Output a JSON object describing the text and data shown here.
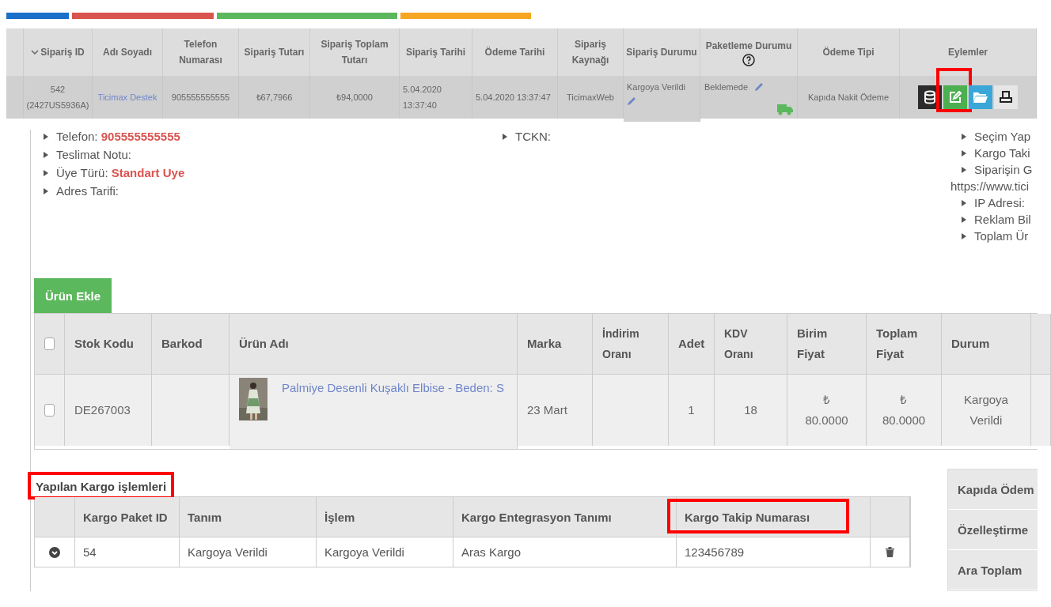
{
  "progress_bars": [
    {
      "color": "#1a6fc9"
    },
    {
      "color": "#d9534f"
    },
    {
      "color": "#5cb85c"
    },
    {
      "color": "#f6a623"
    }
  ],
  "orders_table": {
    "columns": [
      {
        "label": "Sipariş ID",
        "sorted": true,
        "help": false
      },
      {
        "label": "Adı Soyadı",
        "sorted": false,
        "help": false
      },
      {
        "label": "Telefon Numarası",
        "sorted": false,
        "help": false
      },
      {
        "label": "Sipariş Tutarı",
        "sorted": false,
        "help": false
      },
      {
        "label": "Sipariş Toplam Tutarı",
        "sorted": false,
        "help": false
      },
      {
        "label": "Sipariş Tarihi",
        "sorted": false,
        "help": false
      },
      {
        "label": "Ödeme Tarihi",
        "sorted": false,
        "help": false
      },
      {
        "label": "Sipariş Kaynağı",
        "sorted": false,
        "help": false
      },
      {
        "label": "Sipariş Durumu",
        "sorted": false,
        "help": false
      },
      {
        "label": "Paketleme Durumu",
        "sorted": false,
        "help": true
      },
      {
        "label": "Ödeme Tipi",
        "sorted": false,
        "help": false
      },
      {
        "label": "Eylemler",
        "sorted": false,
        "help": false
      }
    ],
    "row": {
      "order_id": "542",
      "order_code": "(2427US5936A)",
      "customer": "Ticimax Destek",
      "phone": "905555555555",
      "amount": "₺67,7966",
      "total": "₺94,0000",
      "order_date": "5.04.2020 13:37:40",
      "payment_date": "5.04.2020 13:37:47",
      "source": "TicimaxWeb",
      "status": "Kargoya Verildi",
      "packaging": "Beklemede",
      "payment_type": "Kapıda Nakit Ödeme",
      "actions": [
        {
          "kind": "database",
          "highlighted": false
        },
        {
          "kind": "edit",
          "highlighted": true
        },
        {
          "kind": "folder",
          "highlighted": false
        },
        {
          "kind": "print",
          "highlighted": false
        }
      ]
    }
  },
  "customer_info": {
    "left": [
      {
        "label": "Telefon:",
        "value": "905555555555"
      },
      {
        "label": "Teslimat Notu:"
      },
      {
        "label": "Üye Türü:",
        "value": "Standart Uye"
      },
      {
        "label": "Adres Tarifi:"
      }
    ],
    "middle": [
      {
        "label": "TCKN:"
      }
    ],
    "right": [
      {
        "kind": "bullet",
        "text": "Seçim Yap"
      },
      {
        "kind": "bullet",
        "text": "Kargo Taki"
      },
      {
        "kind": "bullet",
        "text": "Siparişin G"
      },
      {
        "kind": "plain",
        "text": "https://www.tici"
      },
      {
        "kind": "bullet",
        "text": "IP Adresi:"
      },
      {
        "kind": "bullet",
        "text": "Reklam Bil"
      },
      {
        "kind": "bullet",
        "text": "Toplam Ür"
      }
    ]
  },
  "add_product_button": "Ürün Ekle",
  "products_table": {
    "select_all_checked": false,
    "columns": [
      "Stok Kodu",
      "Barkod",
      "Ürün Adı",
      "Marka",
      "İndirim Oranı",
      "Adet",
      "KDV Oranı",
      "Birim Fiyat",
      "Toplam Fiyat",
      "Durum"
    ],
    "rows": [
      {
        "checked": false,
        "stock_code": "DE267003",
        "product_name": "Palmiye Desenli Kuşaklı Elbise - Beden: S",
        "brand": "23 Mart",
        "quantity": "1",
        "vat": "18",
        "currency": "₺",
        "unit_price": "80.0000",
        "total_price": "80.0000",
        "status": "Kargoya Verildi"
      }
    ]
  },
  "shipping": {
    "title": "Yapılan Kargo işlemleri",
    "title_highlighted": true,
    "columns": [
      {
        "label": "Kargo Paket ID",
        "highlighted": false
      },
      {
        "label": "Tanım",
        "highlighted": false
      },
      {
        "label": "İşlem",
        "highlighted": false
      },
      {
        "label": "Kargo Entegrasyon Tanımı",
        "highlighted": false
      },
      {
        "label": "Kargo Takip Numarası",
        "highlighted": true
      }
    ],
    "rows": [
      {
        "cells": [
          "54",
          "Kargoya Verildi",
          "Kargoya Verildi",
          "Aras Kargo",
          "123456789"
        ]
      }
    ]
  },
  "summary": [
    "Kapıda Ödem",
    "Özelleştirme",
    "Ara Toplam"
  ]
}
